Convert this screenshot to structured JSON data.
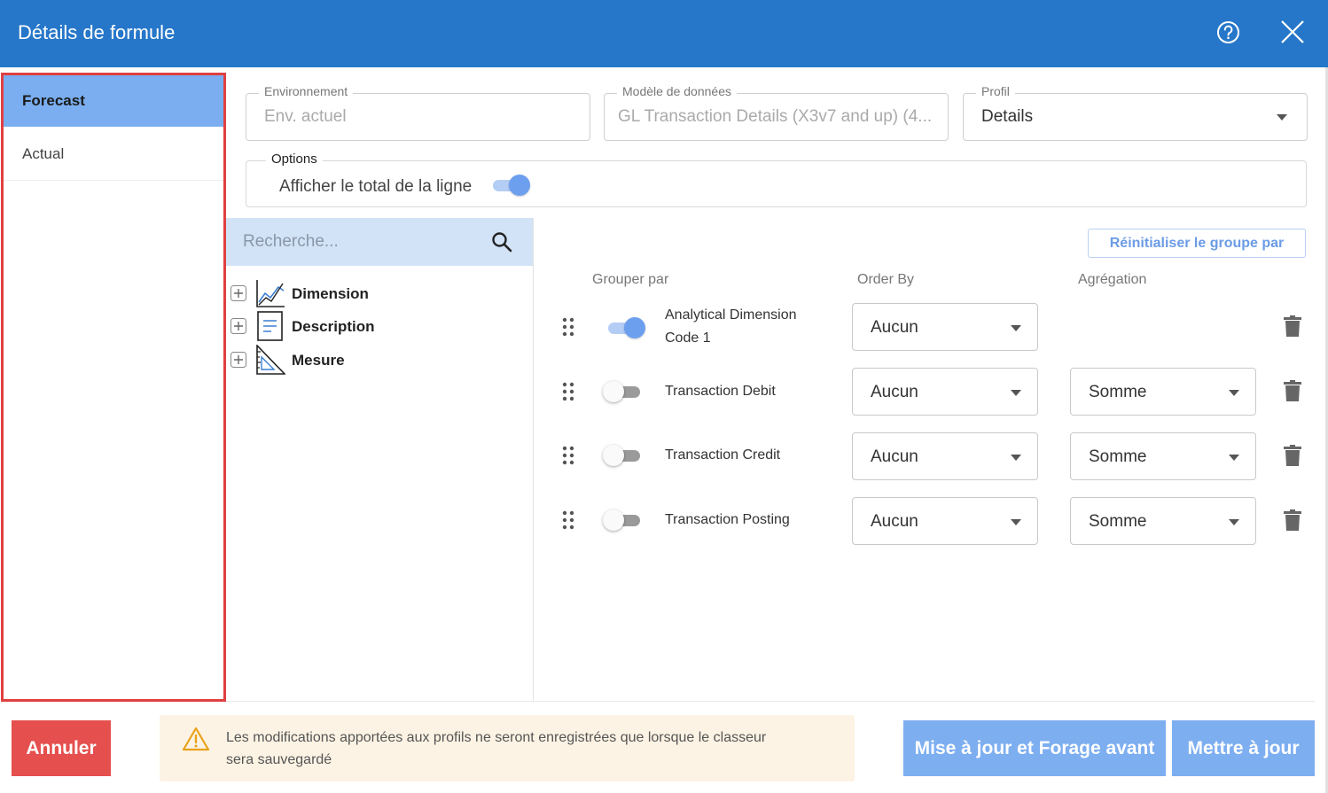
{
  "window": {
    "title": "Détails de formule",
    "help_icon": "help-circle-icon",
    "close_icon": "close-icon"
  },
  "sidebar": {
    "items": [
      {
        "label": "Forecast",
        "active": true
      },
      {
        "label": "Actual",
        "active": false
      }
    ]
  },
  "fields": {
    "environment": {
      "label": "Environnement",
      "placeholder": "Env. actuel"
    },
    "data_model": {
      "label": "Modèle de données",
      "value": "GL Transaction Details (X3v7 and up) (4..."
    },
    "profile": {
      "label": "Profil",
      "value": "Details"
    }
  },
  "options": {
    "label": "Options",
    "show_row_total_label": "Afficher le total de la ligne",
    "show_row_total_on": true
  },
  "tree": {
    "search_placeholder": "Recherche...",
    "nodes": [
      {
        "label": "Dimension",
        "icon": "line-chart-icon"
      },
      {
        "label": "Description",
        "icon": "document-icon"
      },
      {
        "label": "Mesure",
        "icon": "set-square-icon"
      }
    ]
  },
  "grid": {
    "reset_button": "Réinitialiser le groupe par",
    "headers": {
      "group_by": "Grouper par",
      "order_by": "Order By",
      "aggregation": "Agrégation"
    },
    "rows": [
      {
        "name_line1": "Analytical Dimension",
        "name_line2": "Code 1",
        "group_by": true,
        "order_by": "Aucun",
        "aggregation": ""
      },
      {
        "name_line1": "Transaction Debit",
        "name_line2": "",
        "group_by": false,
        "order_by": "Aucun",
        "aggregation": "Somme"
      },
      {
        "name_line1": "Transaction Credit",
        "name_line2": "",
        "group_by": false,
        "order_by": "Aucun",
        "aggregation": "Somme"
      },
      {
        "name_line1": "Transaction Posting",
        "name_line2": "",
        "group_by": false,
        "order_by": "Aucun",
        "aggregation": "Somme"
      }
    ]
  },
  "footer": {
    "cancel": "Annuler",
    "warning_line1": "Les modifications apportées aux profils ne seront enregistrées que lorsque le classeur",
    "warning_line2": "sera sauvegardé",
    "update_drill": "Mise à jour et Forage avant",
    "update": "Mettre à jour"
  },
  "colors": {
    "header_bg": "#2677c9",
    "sidebar_active": "#7aaef0",
    "primary_button": "#7daef0",
    "cancel_button": "#e5504e",
    "warning_bg": "#fcf3e4",
    "selection_outline": "#e04040"
  }
}
